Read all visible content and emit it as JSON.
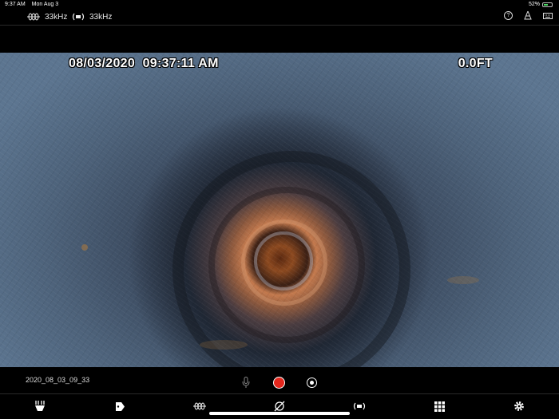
{
  "status_bar": {
    "time": "9:37 AM",
    "date": "Mon Aug 3",
    "battery": "52%",
    "battery_level": 0.52
  },
  "top_bar": {
    "sonde_frequency": "33kHz",
    "locate_frequency": "33kHz",
    "icons": [
      "sonde-frequency-icon",
      "locate-frequency-icon",
      "help-icon",
      "cone-icon",
      "keyboard-icon"
    ]
  },
  "camera": {
    "datetime_overlay": "08/03/2020  09:37:11 AM",
    "distance_overlay": "0.0FT"
  },
  "record_bar": {
    "filename": "2020_08_03_09_33",
    "record_color": "#e3261c"
  },
  "toolbar": {
    "items": [
      "light-icon",
      "tag-icon",
      "sonde-icon",
      "zero-distance-icon",
      "locate-signal-icon",
      "grid-icon",
      "settings-icon"
    ]
  }
}
